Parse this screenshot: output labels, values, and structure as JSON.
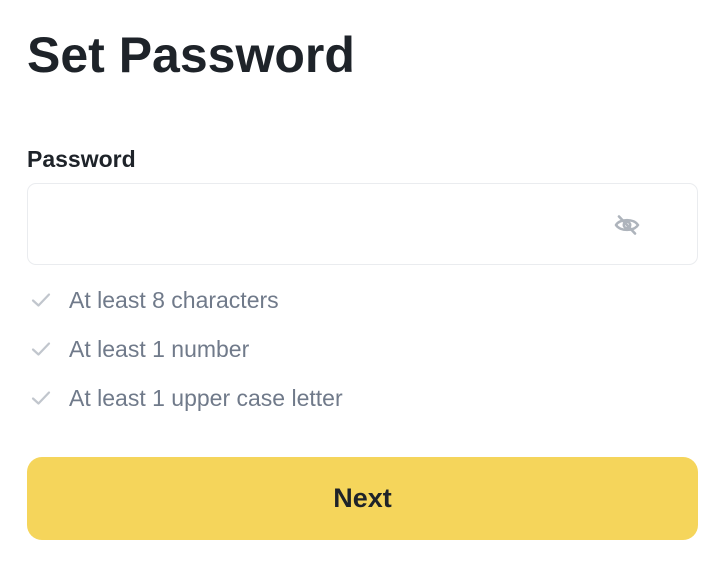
{
  "page": {
    "title": "Set Password"
  },
  "password_field": {
    "label": "Password",
    "value": "",
    "placeholder": "",
    "visibility_icon": "eye-slash-icon"
  },
  "requirements": [
    {
      "text": "At least 8 characters",
      "icon": "check-icon"
    },
    {
      "text": "At least 1 number",
      "icon": "check-icon"
    },
    {
      "text": "At least 1 upper case letter",
      "icon": "check-icon"
    }
  ],
  "actions": {
    "next_label": "Next"
  },
  "colors": {
    "primary_button": "#f5d55b",
    "heading_text": "#1e2329",
    "secondary_text": "#707a8a",
    "icon_gray": "#b7bdc6",
    "field_border": "#eaecef"
  }
}
